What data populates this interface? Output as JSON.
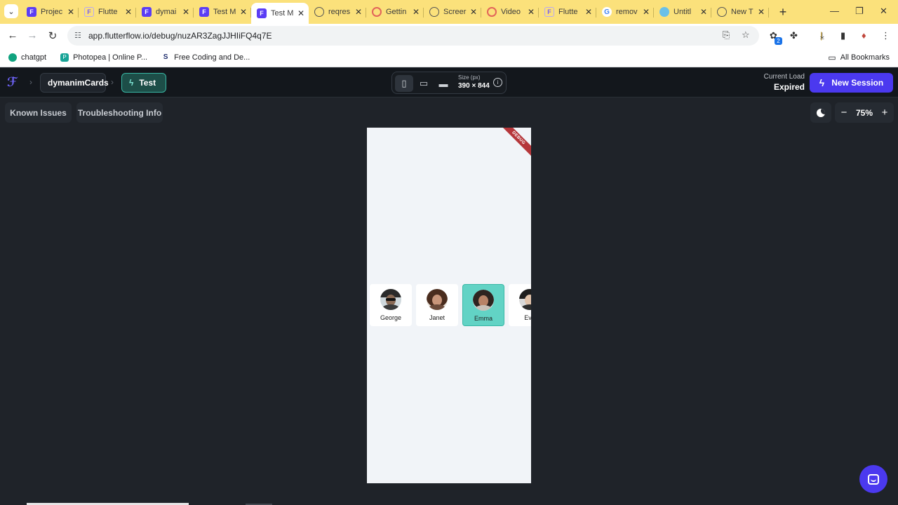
{
  "browser": {
    "tabs": [
      {
        "title": "Projec",
        "icon": "flutterflow-icon"
      },
      {
        "title": "Flutte",
        "icon": "flutterflow-outline-icon"
      },
      {
        "title": "dymai",
        "icon": "flutterflow-icon"
      },
      {
        "title": "Test M",
        "icon": "flutterflow-icon"
      },
      {
        "title": "Test M",
        "icon": "flutterflow-icon",
        "active": true
      },
      {
        "title": "reqres",
        "icon": "globe-icon"
      },
      {
        "title": "Gettin",
        "icon": "red-circle-icon"
      },
      {
        "title": "Screer",
        "icon": "globe-icon"
      },
      {
        "title": "Video",
        "icon": "red-circle-icon"
      },
      {
        "title": "Flutte",
        "icon": "flutterflow-outline-icon"
      },
      {
        "title": "remov",
        "icon": "google-icon"
      },
      {
        "title": "Untitl",
        "icon": "doc-icon"
      },
      {
        "title": "New T",
        "icon": "chrome-icon"
      }
    ],
    "url": "app.flutterflow.io/debug/nuzAR3ZagJJHIiFQ4q7E",
    "extension_badge": "2",
    "bookmarks": [
      {
        "label": "chatgpt",
        "icon": "chatgpt-icon"
      },
      {
        "label": "Photopea | Online P...",
        "icon": "photopea-icon"
      },
      {
        "label": "Free Coding and De...",
        "icon": "s-icon"
      }
    ],
    "all_bookmarks": "All Bookmarks"
  },
  "app": {
    "project_name": "dymanimCards",
    "mode_label": "Test",
    "size_label": "Size (px)",
    "size_value": "390 × 844",
    "load_label": "Current Load",
    "load_value": "Expired",
    "new_session_label": "New Session",
    "known_issues_label": "Known Issues",
    "troubleshooting_label": "Troubleshooting Info",
    "zoom_value": "75%",
    "accent_color": "#4b39ef",
    "test_color": "#39b8a5"
  },
  "preview": {
    "debug_banner": "DEBUG",
    "cards": [
      {
        "name": "George",
        "selected": false
      },
      {
        "name": "Janet",
        "selected": false
      },
      {
        "name": "Emma",
        "selected": true
      },
      {
        "name": "Eve",
        "selected": false
      }
    ]
  }
}
